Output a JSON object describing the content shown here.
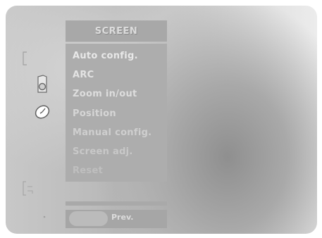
{
  "menu": {
    "title": "SCREEN",
    "items": [
      {
        "label": "Auto config."
      },
      {
        "label": "ARC"
      },
      {
        "label": "Zoom in/out"
      },
      {
        "label": "Position"
      },
      {
        "label": "Manual config."
      },
      {
        "label": "Screen adj."
      },
      {
        "label": "Reset"
      }
    ]
  },
  "footer": {
    "prev_label": "Prev."
  },
  "side_icons": [
    "picture-icon",
    "speaker-icon",
    "clock-icon",
    "input-icon",
    "dot-icon"
  ],
  "colors": {
    "panel": "#adadad",
    "item_text": "#e6e6e6",
    "item_text_faded": "#c4c4c4"
  }
}
